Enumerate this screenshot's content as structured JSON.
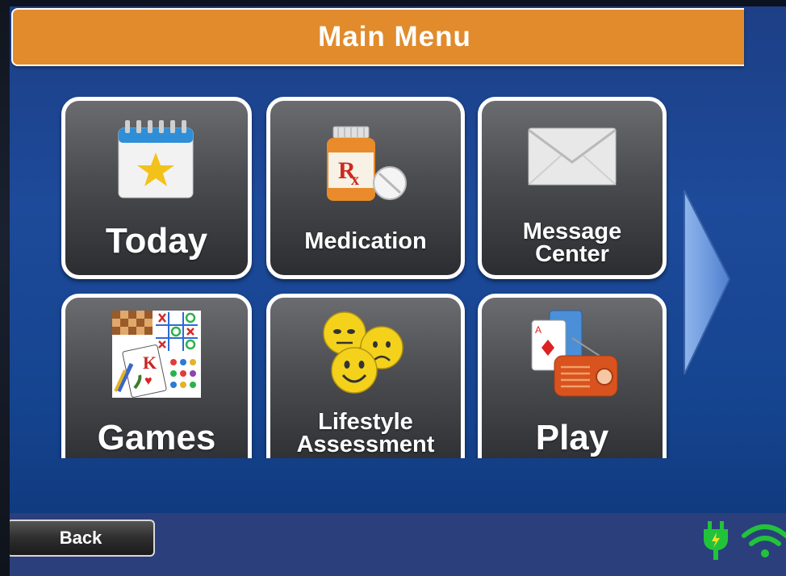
{
  "header": {
    "title": "Main Menu"
  },
  "tiles": [
    {
      "label": "Today",
      "icon": "calendar-star-icon"
    },
    {
      "label": "Medication",
      "icon": "rx-bottle-icon"
    },
    {
      "label": "Message",
      "label2": "Center",
      "icon": "envelope-icon"
    },
    {
      "label": "Games",
      "icon": "games-collage-icon"
    },
    {
      "label": "Lifestyle",
      "label2": "Assessment",
      "icon": "smiley-faces-icon"
    },
    {
      "label": "Play",
      "icon": "cards-radio-icon"
    }
  ],
  "navigation": {
    "next_icon": "next-page-arrow-icon"
  },
  "footer": {
    "back_label": "Back",
    "status_icons": [
      "power-plug-icon",
      "wifi-icon"
    ]
  },
  "colors": {
    "title_bar": "#e18b2c",
    "screen_background": "#1d4a9a",
    "footer_bar": "#2b3f7c",
    "tile_background": "#4a4c50",
    "status_green": "#22c33a"
  }
}
